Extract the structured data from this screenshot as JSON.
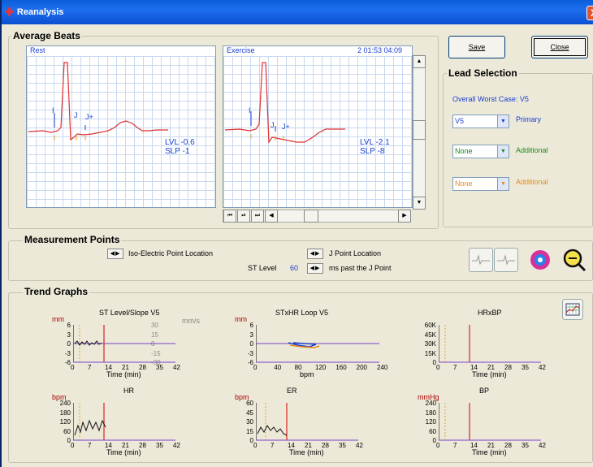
{
  "window": {
    "title": "Reanalysis",
    "close_glyph": "X"
  },
  "average_beats": {
    "legend": "Average Beats",
    "rest": {
      "label": "Rest",
      "markers": {
        "iso": "I",
        "j": "J",
        "jplus": "J+"
      },
      "lvl": "LVL -0.6",
      "slp": "SLP -1"
    },
    "exercise": {
      "label": "Exercise",
      "time": "2  01:53  04:09",
      "markers": {
        "iso": "I",
        "j": "J",
        "jplus": "J+"
      },
      "lvl": "LVL -2.1",
      "slp": "SLP -8"
    },
    "transport": [
      "⏮",
      "⏯",
      "⏭",
      "◀",
      "▶"
    ]
  },
  "buttons": {
    "save": "Save",
    "close": "Close"
  },
  "lead_selection": {
    "legend": "Lead Selection",
    "worst_case": "Overall Worst Case: V5",
    "primary": {
      "value": "V5",
      "label": "Primary"
    },
    "additional1": {
      "value": "None",
      "label": "Additional"
    },
    "additional2": {
      "value": "None",
      "label": "Additional"
    },
    "colors": {
      "primary": "#1a3fd0",
      "additional1": "#1a8a1a",
      "additional2": "#e88a1a"
    }
  },
  "measurement": {
    "legend": "Measurement Points",
    "iso_label": "Iso-Electric Point Location",
    "j_label": "J Point Location",
    "st_level_label": "ST Level",
    "st_level_value": "60",
    "ms_label": "ms past the J Point"
  },
  "trend": {
    "legend": "Trend Graphs",
    "xticks": [
      "0",
      "7",
      "14",
      "21",
      "28",
      "35",
      "42"
    ],
    "xlabel": "Time (min)",
    "st": {
      "title": "ST Level/Slope V5",
      "unit_left": "mm",
      "unit_right": "mm/s",
      "yticks": [
        "6",
        "3",
        "0",
        "-3",
        "-6"
      ],
      "yticks_right": [
        "30",
        "15",
        "0",
        "-15",
        "-30"
      ]
    },
    "loop": {
      "title": "STxHR Loop V5",
      "unit": "mm",
      "yticks": [
        "6",
        "3",
        "0",
        "-3",
        "-6"
      ],
      "xticks": [
        "0",
        "40",
        "80",
        "120",
        "160",
        "200",
        "240"
      ],
      "xlabel": "bpm"
    },
    "hrxbp": {
      "title": "HRxBP",
      "yticks": [
        "60K",
        "45K",
        "30K",
        "15K",
        "0"
      ]
    },
    "hr": {
      "title": "HR",
      "unit": "bpm",
      "yticks": [
        "240",
        "180",
        "120",
        "60",
        "0"
      ]
    },
    "er": {
      "title": "ER",
      "unit": "bpm",
      "yticks": [
        "60",
        "45",
        "30",
        "15",
        "0"
      ]
    },
    "bp": {
      "title": "BP",
      "unit": "mmHg",
      "yticks": [
        "240",
        "180",
        "120",
        "60",
        "0"
      ]
    }
  }
}
